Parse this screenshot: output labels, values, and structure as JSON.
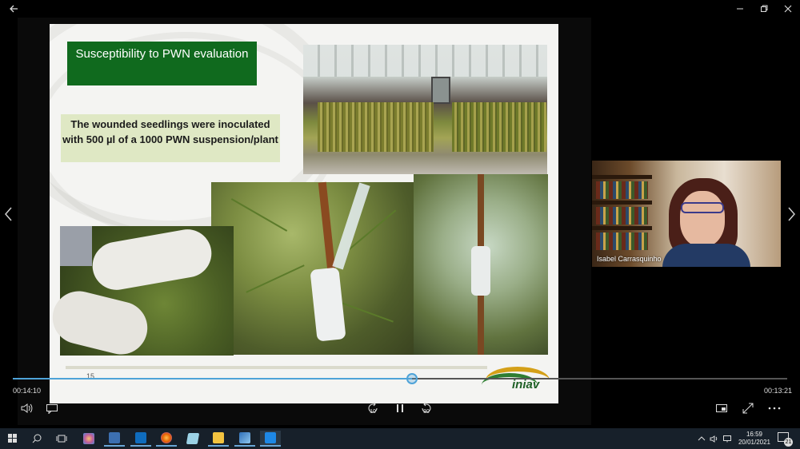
{
  "slide": {
    "title": "Susceptibility to PWN evaluation",
    "note": "The wounded seedlings were inoculated with 500 µl of a 1000 PWN suspension/plant",
    "slide_number": "15",
    "logo_text": "iniav"
  },
  "participant": {
    "name": "Isabel Carrasquinho"
  },
  "player": {
    "elapsed": "00:14:10",
    "remaining": "00:13:21",
    "progress_fraction": 0.515,
    "rewind_seconds": "10",
    "forward_seconds": "30"
  },
  "taskbar": {
    "clock_time": "16:59",
    "clock_date": "20/01/2021",
    "notification_count": "21"
  },
  "colors": {
    "slide_title_bg": "#106a1e",
    "note_bg": "#dfe8c4",
    "progress_accent": "#4ea3d8",
    "taskbar_bg": "#17202a"
  },
  "icons": {
    "back": "back-arrow-icon",
    "minimize": "minimize-icon",
    "restore": "restore-icon",
    "close": "close-icon",
    "volume": "volume-icon",
    "captions": "captions-icon",
    "rewind": "rewind-icon",
    "pause": "pause-icon",
    "forward": "forward-icon",
    "miniplayer": "miniplayer-icon",
    "fullscreen": "fullscreen-icon",
    "more": "more-icon"
  }
}
